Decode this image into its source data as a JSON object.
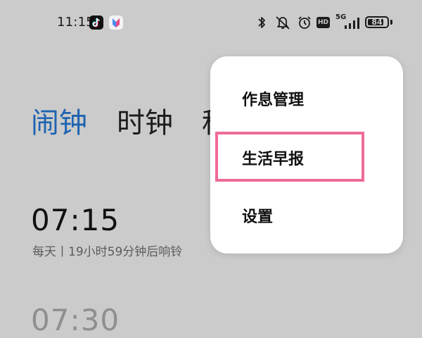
{
  "status_bar": {
    "time": "11:15",
    "network": "5G",
    "battery": "84",
    "battery_level": 0.84,
    "hd_label": "HD"
  },
  "tabs": [
    {
      "label": "闹钟",
      "active": true
    },
    {
      "label": "时钟",
      "active": false
    },
    {
      "label": "秒表",
      "active": false
    }
  ],
  "alarms": [
    {
      "time": "07:15",
      "description": "每天丨19小时59分钟后响铃"
    },
    {
      "time": "07:30"
    }
  ],
  "menu": {
    "items": [
      {
        "label": "作息管理"
      },
      {
        "label": "生活早报",
        "highlighted": true
      },
      {
        "label": "设置"
      }
    ]
  },
  "colors": {
    "accent": "#1d63b0",
    "highlight_border": "#ef6c98",
    "background": "#cbcbcb"
  },
  "icons": [
    "tiktok-icon",
    "app-store-icon",
    "bluetooth-icon",
    "mute-icon",
    "alarm-icon",
    "signal-icon",
    "battery-icon"
  ]
}
